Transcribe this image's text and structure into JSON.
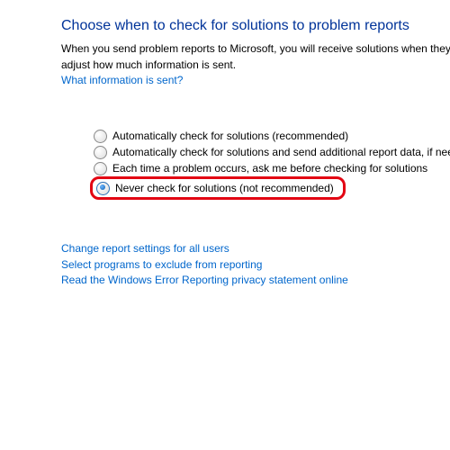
{
  "heading": "Choose when to check for solutions to problem reports",
  "description_line1": "When you send problem reports to Microsoft, you will receive solutions when they",
  "description_line2": "adjust how much information is sent.",
  "info_link": "What information is sent?",
  "options": [
    {
      "label": "Automatically check for solutions (recommended)",
      "selected": false
    },
    {
      "label": "Automatically check for solutions and send additional report data, if need",
      "selected": false
    },
    {
      "label": "Each time a problem occurs, ask me before checking for solutions",
      "selected": false
    },
    {
      "label": "Never check for solutions (not recommended)",
      "selected": true
    }
  ],
  "links": {
    "change_all_users": "Change report settings for all users",
    "exclude_programs": "Select programs to exclude from reporting",
    "privacy": "Read the Windows Error Reporting privacy statement online"
  },
  "highlight_color": "#e30613"
}
